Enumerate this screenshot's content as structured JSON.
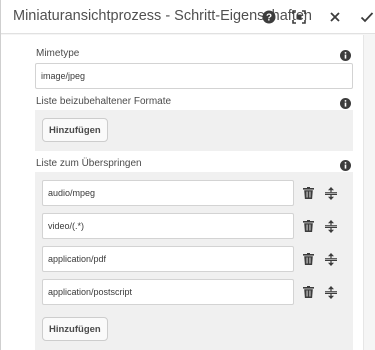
{
  "dialog": {
    "title": "Miniaturansichtprozess - Schritt-Eigenschaften",
    "icons": [
      "help-icon",
      "fullscreen-icon",
      "close-icon",
      "checkmark-icon"
    ]
  },
  "mimetype": {
    "label": "Mimetype",
    "value": "image/jpeg"
  },
  "keep_formats": {
    "label": "Liste beizubehaltener Formate",
    "add_label": "Hinzufügen"
  },
  "skip_list": {
    "label": "Liste zum Überspringen",
    "items": [
      {
        "value": "audio/mpeg"
      },
      {
        "value": "video/(.*)"
      },
      {
        "value": "application/pdf"
      },
      {
        "value": "application/postscript"
      }
    ],
    "add_label": "Hinzufügen"
  },
  "colors": {
    "well_bg": "#f0f0f0",
    "text": "#4b4b4b",
    "icon": "#3c3c3c"
  }
}
